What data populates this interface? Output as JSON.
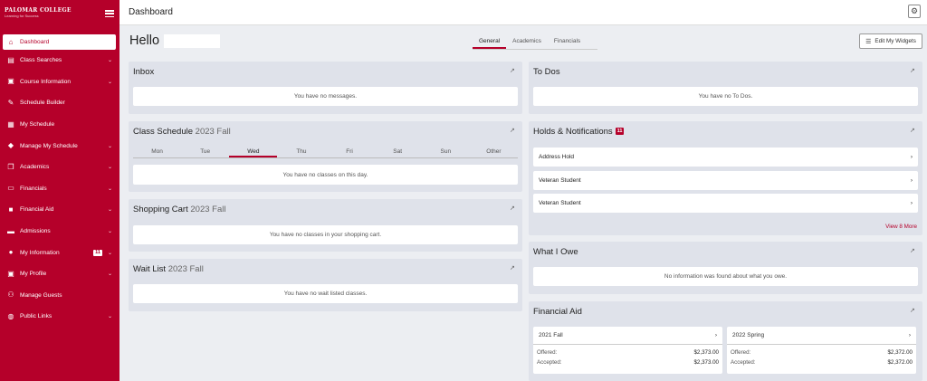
{
  "logo": {
    "name": "PALOMAR COLLEGE",
    "tagline": "Learning for Success"
  },
  "sidebar": {
    "items": [
      {
        "label": "Dashboard",
        "icon": "home-icon"
      },
      {
        "label": "Class Searches",
        "icon": "search-list-icon"
      },
      {
        "label": "Course Information",
        "icon": "book-icon"
      },
      {
        "label": "Schedule Builder",
        "icon": "edit-icon"
      },
      {
        "label": "My Schedule",
        "icon": "calendar-icon"
      },
      {
        "label": "Manage My Schedule",
        "icon": "graduation-cap-icon"
      },
      {
        "label": "Academics",
        "icon": "documents-icon"
      },
      {
        "label": "Financials",
        "icon": "credit-card-icon"
      },
      {
        "label": "Financial Aid",
        "icon": "folder-icon"
      },
      {
        "label": "Admissions",
        "icon": "id-card-icon"
      },
      {
        "label": "My Information",
        "icon": "info-icon",
        "badge": "11"
      },
      {
        "label": "My Profile",
        "icon": "profile-icon"
      },
      {
        "label": "Manage Guests",
        "icon": "users-icon"
      },
      {
        "label": "Public Links",
        "icon": "globe-icon"
      }
    ]
  },
  "header": {
    "title": "Dashboard"
  },
  "greeting": "Hello",
  "tabs": [
    "General",
    "Academics",
    "Financials"
  ],
  "edit_widgets": "Edit My Widgets",
  "inbox": {
    "title": "Inbox",
    "empty": "You have no messages."
  },
  "schedule": {
    "title": "Class Schedule",
    "term": "2023 Fall",
    "days": [
      "Mon",
      "Tue",
      "Wed",
      "Thu",
      "Fri",
      "Sat",
      "Sun",
      "Other"
    ],
    "active_day": "Wed",
    "empty": "You have no classes on this day."
  },
  "cart": {
    "title": "Shopping Cart",
    "term": "2023 Fall",
    "empty": "You have no classes in your shopping cart."
  },
  "waitlist": {
    "title": "Wait List",
    "term": "2023 Fall",
    "empty": "You have no wait listed classes."
  },
  "todos": {
    "title": "To Dos",
    "empty": "You have no To Dos."
  },
  "holds": {
    "title": "Holds & Notifications",
    "badge": "11",
    "items": [
      "Address Hold",
      "Veteran Student",
      "Veteran Student"
    ],
    "more": "View 8 More"
  },
  "owe": {
    "title": "What I Owe",
    "empty": "No information was found about what you owe."
  },
  "aid": {
    "title": "Financial Aid",
    "terms": [
      {
        "name": "2021 Fall",
        "offered_label": "Offered:",
        "offered": "$2,373.00",
        "accepted_label": "Accepted:",
        "accepted": "$2,373.00"
      },
      {
        "name": "2022 Spring",
        "offered_label": "Offered:",
        "offered": "$2,372.00",
        "accepted_label": "Accepted:",
        "accepted": "$2,372.00"
      }
    ]
  },
  "colors": {
    "accent": "#b5002a",
    "panel": "#dfe2ea",
    "background": "#eceef2"
  }
}
